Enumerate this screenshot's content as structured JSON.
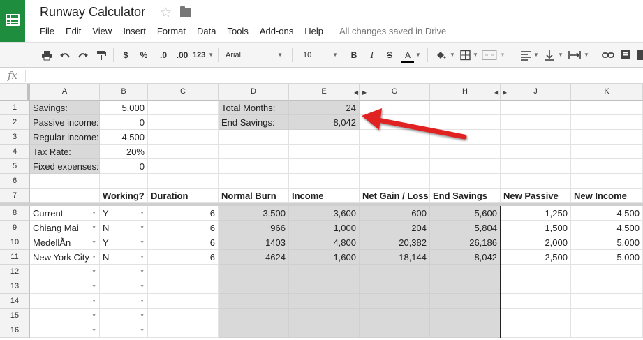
{
  "app": {
    "title": "Runway Calculator",
    "save_status": "All changes saved in Drive",
    "star_icon": "☆"
  },
  "menu": [
    "File",
    "Edit",
    "View",
    "Insert",
    "Format",
    "Data",
    "Tools",
    "Add-ons",
    "Help"
  ],
  "toolbar": {
    "currency": "$",
    "percent": "%",
    "dec_decrease": ".0",
    "dec_increase": ".00",
    "more_formats": "123",
    "font": "Arial",
    "font_size": "10",
    "bold": "B",
    "italic": "I",
    "strike": "S",
    "text_color": "A",
    "colors": {
      "accent": "#1e8e3e",
      "text_color_bar": "#000000",
      "fill_bar": "#ffffff"
    }
  },
  "formula_bar": {
    "icon": "fx",
    "value": ""
  },
  "columns": [
    "A",
    "B",
    "C",
    "D",
    "E",
    "F",
    "G",
    "H",
    "I",
    "J",
    "K"
  ],
  "rows": [
    "1",
    "2",
    "3",
    "4",
    "5",
    "6",
    "7",
    "8",
    "9",
    "10",
    "11",
    "12",
    "13",
    "14",
    "15",
    "16"
  ],
  "inputs": {
    "savings_label": "Savings:",
    "savings": "5,000",
    "passive_label": "Passive income:",
    "passive": "0",
    "regular_label": "Regular income:",
    "regular": "4,500",
    "tax_label": "Tax Rate:",
    "tax": "20%",
    "fixed_label": "Fixed expenses:",
    "fixed": "0"
  },
  "summary": {
    "total_months_label": "Total Months:",
    "total_months": "24",
    "end_savings_label": "End Savings:",
    "end_savings": "8,042"
  },
  "table": {
    "headers": [
      "Working?",
      "Duration",
      "Normal Burn",
      "Income",
      "Net Gain / Loss",
      "End Savings",
      "New Passive",
      "New Income"
    ],
    "rows": [
      [
        "Current",
        "Y",
        "6",
        "3,500",
        "3,600",
        "600",
        "5,600",
        "1,250",
        "4,500"
      ],
      [
        "Chiang Mai",
        "N",
        "6",
        "966",
        "1,000",
        "204",
        "5,804",
        "1,500",
        "4,500"
      ],
      [
        "MedellÃn",
        "Y",
        "6",
        "1403",
        "4,800",
        "20,382",
        "26,186",
        "2,000",
        "5,000"
      ],
      [
        "New York City",
        "N",
        "6",
        "4624",
        "1,600",
        "-18,144",
        "8,042",
        "2,500",
        "5,000"
      ]
    ]
  },
  "annotation": {
    "arrow_color": "#e02020"
  }
}
